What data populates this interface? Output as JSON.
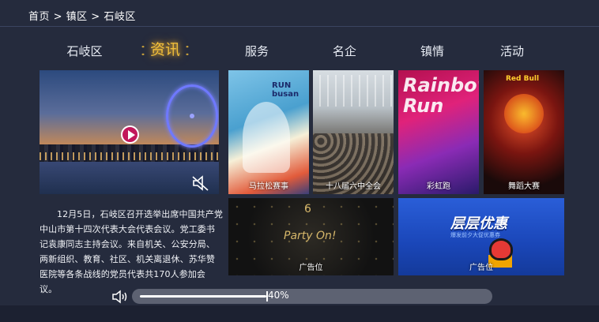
{
  "breadcrumb": {
    "text": "首页 > 镇区 > 石岐区"
  },
  "tabs": [
    {
      "label": "石岐区",
      "active": false
    },
    {
      "label": "资讯",
      "active": true
    },
    {
      "label": "服务",
      "active": false
    },
    {
      "label": "名企",
      "active": false
    },
    {
      "label": "镇情",
      "active": false
    },
    {
      "label": "活动",
      "active": false
    }
  ],
  "video": {
    "play_icon": "play-icon",
    "mute_icon": "mute-icon"
  },
  "article": {
    "text": "12月5日，石岐区召开选举出席中国共产党中山市第十四次代表大会代表会议。党工委书记袁康同志主持会议。来自机关、公安分局、两新组织、教育、社区、机关离退休、苏华赞医院等各条战线的党员代表共170人参加会议。"
  },
  "tiles": [
    {
      "caption": "马拉松赛事",
      "logo": "RUN busan"
    },
    {
      "caption": "十八届六中全会"
    },
    {
      "caption": "彩虹跑",
      "art_text": "Rainbow Run"
    },
    {
      "caption": "舞蹈大赛",
      "logo": "Red Bull"
    },
    {
      "caption": "广告位",
      "art_text": "Party On!",
      "art_num": "6"
    },
    {
      "caption": "广告位",
      "art_text": "层层优惠",
      "art_sub": "爆发前夕大促优惠券"
    }
  ],
  "volume": {
    "percent": 40,
    "label": "40%",
    "icon": "speaker-icon"
  },
  "colors": {
    "background": "#252b3d",
    "active_tab": "#f2bf3a",
    "track": "#5d6272"
  }
}
